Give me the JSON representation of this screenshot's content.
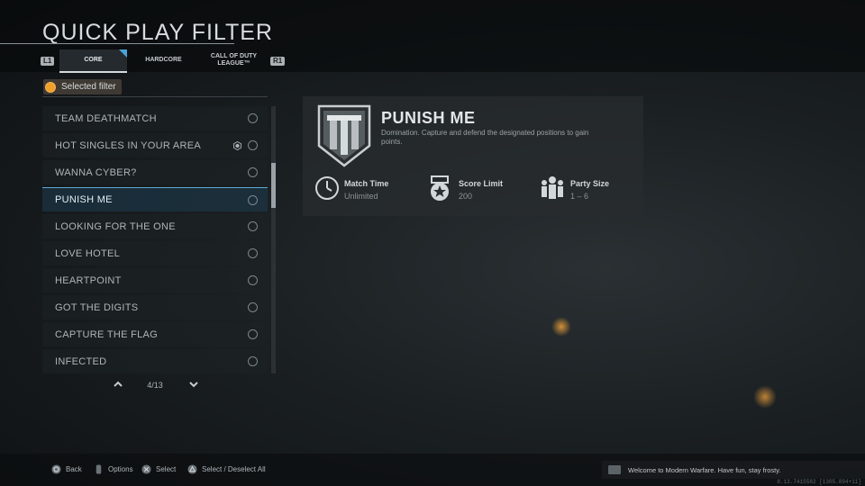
{
  "page": {
    "title": "QUICK PLAY FILTER"
  },
  "tabs": {
    "left_hint": "L1",
    "right_hint": "R1",
    "items": [
      {
        "label": "CORE",
        "active": true
      },
      {
        "label": "HARDCORE",
        "active": false
      },
      {
        "label": "CALL OF DUTY LEAGUE™",
        "active": false
      }
    ]
  },
  "legend": {
    "label": "Selected filter",
    "dot_color": "#f0a02a"
  },
  "list": {
    "items": [
      {
        "label": "TEAM DEATHMATCH"
      },
      {
        "label": "HOT SINGLES IN YOUR AREA",
        "extra_icon": "hexagon-badge-icon"
      },
      {
        "label": "WANNA CYBER?"
      },
      {
        "label": "PUNISH ME",
        "selected": true
      },
      {
        "label": "LOOKING FOR THE ONE"
      },
      {
        "label": "LOVE HOTEL"
      },
      {
        "label": "HEARTPOINT"
      },
      {
        "label": "GOT THE DIGITS"
      },
      {
        "label": "CAPTURE THE FLAG"
      },
      {
        "label": "INFECTED"
      }
    ],
    "pager": "4/13",
    "scroll_position": 0.31
  },
  "detail": {
    "title": "PUNISH ME",
    "description": "Domination. Capture and defend the designated positions to gain points.",
    "stats": [
      {
        "label": "Match Time",
        "value": "Unlimited",
        "icon": "clock-icon"
      },
      {
        "label": "Score Limit",
        "value": "200",
        "icon": "score-medal-icon"
      },
      {
        "label": "Party Size",
        "value": "1 – 6",
        "icon": "party-icon"
      }
    ]
  },
  "footer": {
    "hints": [
      {
        "label": "Back",
        "icon": "circle-button-icon"
      },
      {
        "label": "Options",
        "icon": "touchpad-button-icon"
      },
      {
        "label": "Select",
        "icon": "cross-button-icon"
      },
      {
        "label": "Select / Deselect All",
        "icon": "triangle-button-icon"
      }
    ],
    "message": "Welcome to Modern Warfare. Have fun, stay frosty.",
    "version": "8.13.7415582 [1305.894+11]"
  }
}
